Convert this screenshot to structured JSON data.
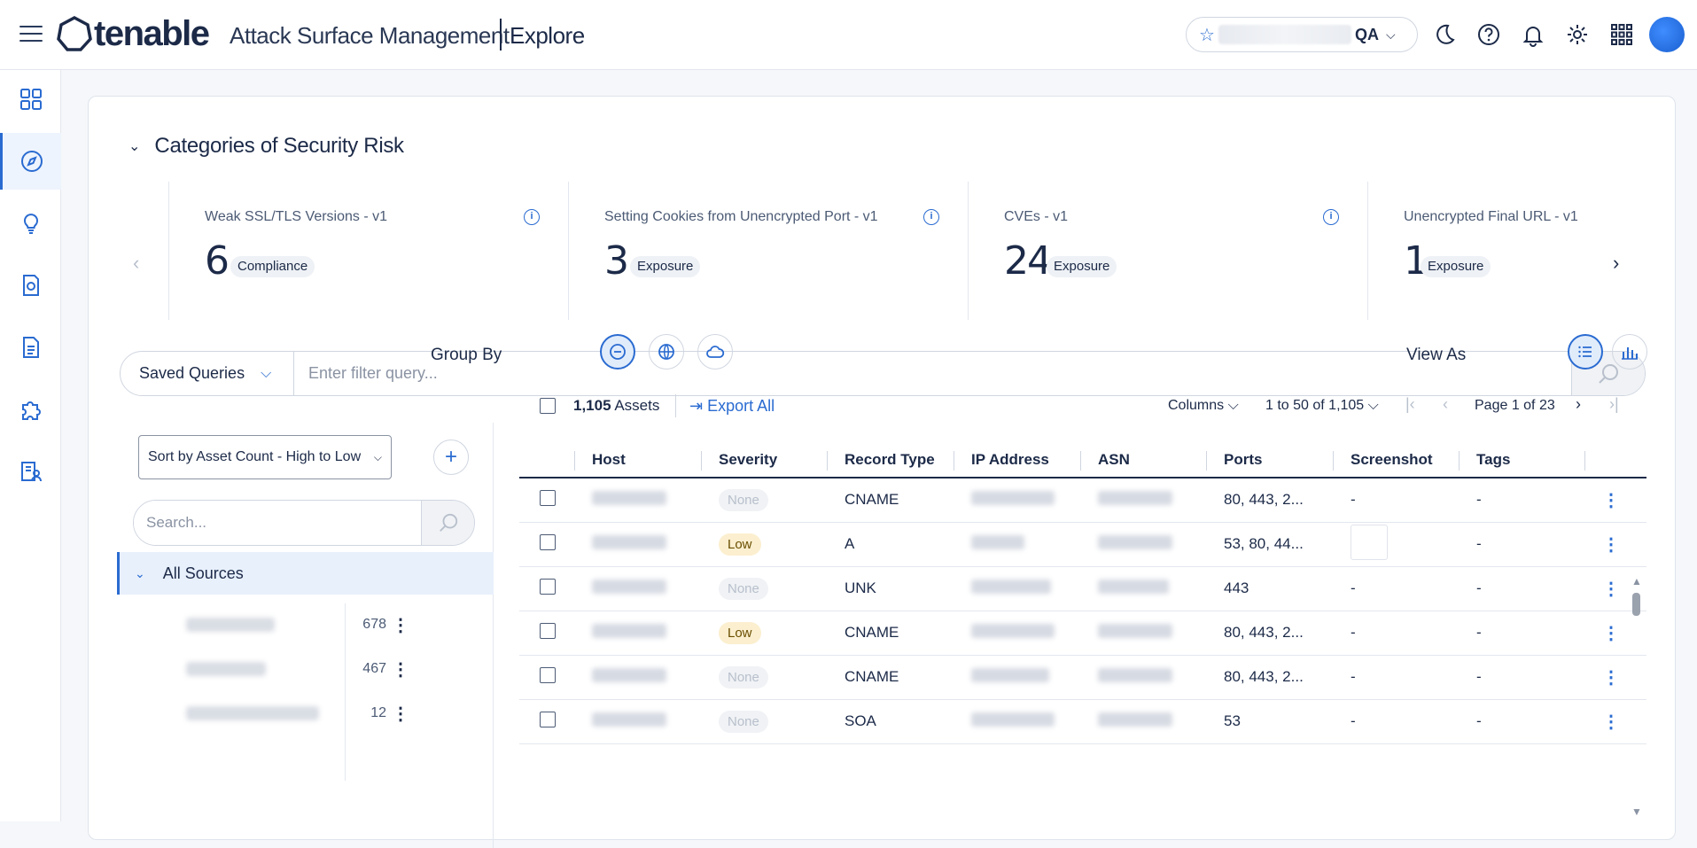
{
  "header": {
    "brand": "tenable",
    "app_name": "Attack Surface Management",
    "page_name": "Explore",
    "workspace_suffix": "QA"
  },
  "risk_section": {
    "title": "Categories of Security Risk",
    "cards": [
      {
        "title": "Weak SSL/TLS Versions - v1",
        "count": "6",
        "badge": "Compliance"
      },
      {
        "title": "Setting Cookies from Unencrypted Port - v1",
        "count": "3",
        "badge": "Exposure"
      },
      {
        "title": "CVEs - v1",
        "count": "24",
        "badge": "Exposure"
      },
      {
        "title": "Unencrypted Final URL - v1",
        "count": "1",
        "badge": "Exposure"
      }
    ]
  },
  "query": {
    "saved_label": "Saved Queries",
    "placeholder": "Enter filter query..."
  },
  "sources": {
    "sort_label": "Sort by Asset Count - High to Low",
    "search_placeholder": "Search...",
    "all_label": "All Sources",
    "items": [
      {
        "count": "678"
      },
      {
        "count": "467"
      },
      {
        "count": "12"
      }
    ]
  },
  "assets": {
    "group_by_label": "Group By",
    "view_as_label": "View As",
    "count": "1,105",
    "count_suffix": "Assets",
    "export_label": "Export All",
    "columns_label": "Columns",
    "range_label": "1 to 50 of 1,105",
    "page_label": "Page 1 of 23",
    "headers": [
      "Host",
      "Severity",
      "Record Type",
      "IP Address",
      "ASN",
      "Ports",
      "Screenshot",
      "Tags"
    ],
    "rows": [
      {
        "severity": "None",
        "record_type": "CNAME",
        "ports": "80, 443, 2...",
        "screenshot": "-",
        "tags": "-"
      },
      {
        "severity": "Low",
        "record_type": "A",
        "ports": "53, 80, 44...",
        "screenshot": "",
        "tags": "-"
      },
      {
        "severity": "None",
        "record_type": "UNK",
        "ports": "443",
        "screenshot": "-",
        "tags": "-"
      },
      {
        "severity": "Low",
        "record_type": "CNAME",
        "ports": "80, 443, 2...",
        "screenshot": "-",
        "tags": "-"
      },
      {
        "severity": "None",
        "record_type": "CNAME",
        "ports": "80, 443, 2...",
        "screenshot": "-",
        "tags": "-"
      },
      {
        "severity": "None",
        "record_type": "SOA",
        "ports": "53",
        "screenshot": "-",
        "tags": "-"
      }
    ]
  },
  "colors": {
    "accent": "#2a6bd1",
    "navy": "#1c2a48",
    "low_badge": "#fbefcf"
  }
}
